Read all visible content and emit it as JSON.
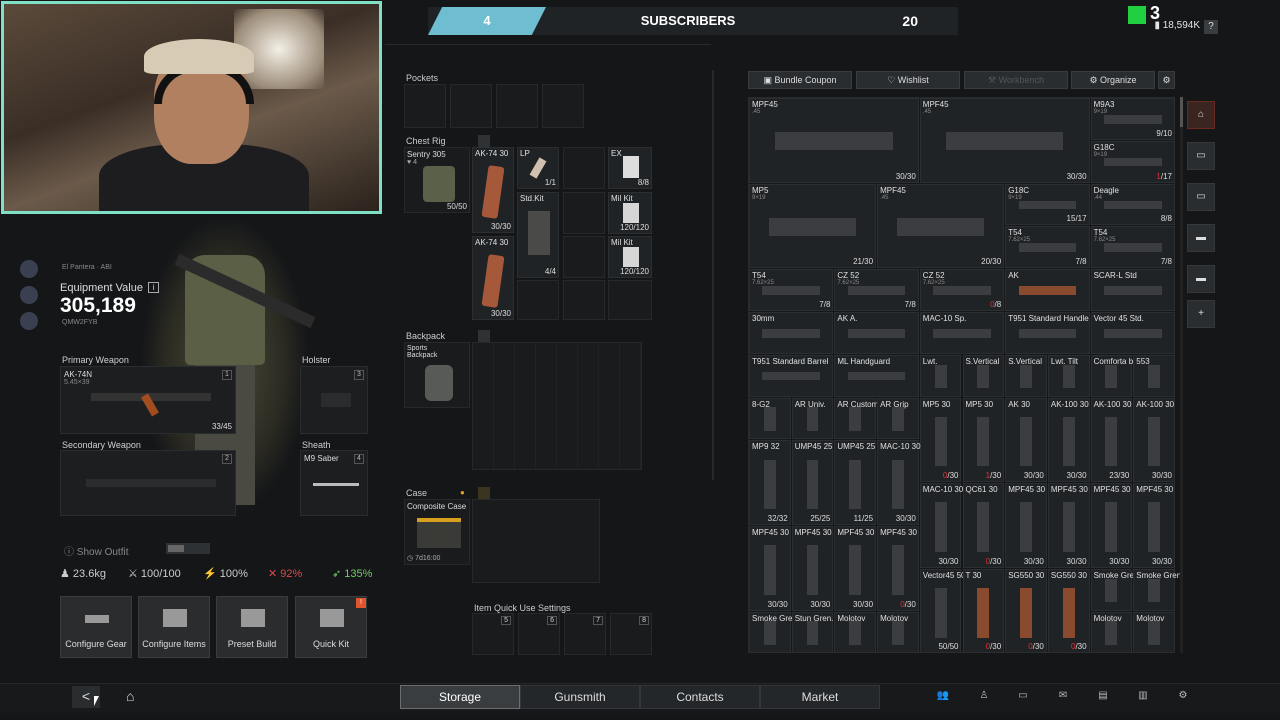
{
  "stream_overlay": {
    "subscribers_current": "4",
    "subscribers_label": "SUBSCRIBERS",
    "subscribers_goal": "20"
  },
  "header": {
    "level": "3",
    "currency": "18,594K",
    "help": "?"
  },
  "player": {
    "name": "El Pantera",
    "rank_tag": "ABI",
    "equipment_value_label": "Equipment Value",
    "equipment_value": "305,189",
    "player_id": "QMW2FYB"
  },
  "loadout": {
    "primary": {
      "title": "Primary Weapon",
      "name": "AK-74N",
      "caliber": "5.45×39",
      "slot": "1",
      "ammo": "33/45"
    },
    "secondary": {
      "title": "Secondary Weapon",
      "slot": "2"
    },
    "holster": {
      "title": "Holster",
      "slot": "3"
    },
    "sheath": {
      "title": "Sheath",
      "name": "M9 Saber",
      "slot": "4"
    }
  },
  "stats": {
    "show_outfit": "Show Outfit",
    "weight": "23.6kg",
    "durability": "100/100",
    "stamina": "100%",
    "health_penalty": "92%",
    "speed": "135%"
  },
  "actions": {
    "configure_gear": "Configure Gear",
    "configure_items": "Configure Items",
    "preset_build": "Preset Build",
    "quick_kit": "Quick Kit",
    "quick_kit_badge": "!"
  },
  "containers": {
    "pockets": "Pockets",
    "chest_rig": {
      "title": "Chest Rig",
      "name": "Sentry 305",
      "level": "4",
      "capacity": "50/50"
    },
    "chest_items": [
      {
        "name": "AK-74 30",
        "qty": "30/30"
      },
      {
        "name": "LP",
        "qty": "1/1"
      },
      {
        "name": "EX",
        "qty": "8/8"
      },
      {
        "name": "Std.Kit",
        "qty": "4/4"
      },
      {
        "name": "Mil Kit",
        "qty": "120/120"
      },
      {
        "name": "AK-74 30",
        "qty": "30/30"
      },
      {
        "name": "Mil Kit",
        "qty": "120/120"
      }
    ],
    "backpack": {
      "title": "Backpack",
      "name": "Sports Backpack"
    },
    "case": {
      "title": "Case",
      "name": "Composite Case",
      "timer": "7d16:00"
    },
    "quick_use": {
      "title": "Item Quick Use Settings",
      "slots": [
        "5",
        "6",
        "7",
        "8"
      ]
    }
  },
  "storage_toolbar": {
    "bundle_coupon": "Bundle Coupon",
    "wishlist": "Wishlist",
    "workbench": "Workbench",
    "organize": "Organize"
  },
  "storage_items": [
    {
      "name": "MPF45",
      "sub": ".45",
      "qty": "30/30"
    },
    {
      "name": "MPF45",
      "sub": ".45",
      "qty": "30/30"
    },
    {
      "name": "M9A3",
      "sub": "9×19",
      "qty": "9/10"
    },
    {
      "name": "G18C",
      "sub": "9×19",
      "qty": "1/17"
    },
    {
      "name": "MP5",
      "sub": "9×19",
      "qty": "21/30"
    },
    {
      "name": "MPF45",
      "sub": ".45",
      "qty": "20/30"
    },
    {
      "name": "G18C",
      "sub": "9×19",
      "qty": "15/17"
    },
    {
      "name": "Deagle",
      "sub": ".44",
      "qty": "8/8"
    },
    {
      "name": "T54",
      "sub": "7.62×25",
      "qty": "7/8"
    },
    {
      "name": "T54",
      "sub": "7.62×25",
      "qty": "7/8"
    },
    {
      "name": "T54",
      "sub": "7.62×25",
      "qty": "7/8"
    },
    {
      "name": "CZ 52",
      "sub": "7.62×25",
      "qty": "7/8"
    },
    {
      "name": "CZ 52",
      "sub": "7.62×25",
      "qty": "0/8"
    },
    {
      "name": "AK",
      "sub": "",
      "qty": ""
    },
    {
      "name": "SCAR-L Std",
      "sub": "",
      "qty": ""
    },
    {
      "name": "30mm",
      "sub": "",
      "qty": ""
    },
    {
      "name": "AK A.",
      "sub": "",
      "qty": ""
    },
    {
      "name": "MAC-10 Sp.",
      "sub": "",
      "qty": ""
    },
    {
      "name": "T951 Standard Handle",
      "sub": "",
      "qty": ""
    },
    {
      "name": "Vector 45 Std.",
      "sub": "",
      "qty": ""
    },
    {
      "name": "T951 Standard Barrel",
      "sub": "",
      "qty": ""
    },
    {
      "name": "ML Handguard",
      "sub": "",
      "qty": ""
    },
    {
      "name": "Lwt.",
      "sub": "",
      "qty": ""
    },
    {
      "name": "S.Vertical",
      "sub": "",
      "qty": ""
    },
    {
      "name": "S.Vertical",
      "sub": "",
      "qty": ""
    },
    {
      "name": "Lwt. Tilt",
      "sub": "",
      "qty": ""
    },
    {
      "name": "Comforta ble FG",
      "sub": "",
      "qty": ""
    },
    {
      "name": "553",
      "sub": "",
      "qty": ""
    },
    {
      "name": "8-G2",
      "sub": "",
      "qty": ""
    },
    {
      "name": "AR Univ.",
      "sub": "",
      "qty": ""
    },
    {
      "name": "AR Custom",
      "sub": "",
      "qty": ""
    },
    {
      "name": "AR Grip",
      "sub": "",
      "qty": ""
    },
    {
      "name": "MP5 30",
      "sub": "",
      "qty": "0/30"
    },
    {
      "name": "MP5 30",
      "sub": "",
      "qty": "1/30"
    },
    {
      "name": "AK 30",
      "sub": "",
      "qty": "30/30"
    },
    {
      "name": "AK-100 30",
      "sub": "",
      "qty": "30/30"
    },
    {
      "name": "AK-100 30",
      "sub": "",
      "qty": "23/30"
    },
    {
      "name": "AK-100 30",
      "sub": "",
      "qty": "30/30"
    },
    {
      "name": "MP9 32",
      "sub": "",
      "qty": "32/32"
    },
    {
      "name": "UMP45 25",
      "sub": "",
      "qty": "25/25"
    },
    {
      "name": "UMP45 25",
      "sub": "",
      "qty": "11/25"
    },
    {
      "name": "MAC-10 30",
      "sub": "",
      "qty": "30/30"
    },
    {
      "name": "MAC-10 30",
      "sub": "",
      "qty": "30/30"
    },
    {
      "name": "QC61 30",
      "sub": "",
      "qty": "0/30"
    },
    {
      "name": "MPF45 30",
      "sub": "",
      "qty": "30/30"
    },
    {
      "name": "MPF45 30",
      "sub": "",
      "qty": "30/30"
    },
    {
      "name": "MPF45 30",
      "sub": "",
      "qty": "30/30"
    },
    {
      "name": "MPF45 30",
      "sub": "",
      "qty": "30/30"
    },
    {
      "name": "MPF45 30",
      "sub": "",
      "qty": "30/30"
    },
    {
      "name": "MPF45 30",
      "sub": "",
      "qty": "30/30"
    },
    {
      "name": "MPF45 30",
      "sub": "",
      "qty": "30/30"
    },
    {
      "name": "MPF45 30",
      "sub": "",
      "qty": "0/30"
    },
    {
      "name": "Vector45 50",
      "sub": "",
      "qty": "50/50"
    },
    {
      "name": "T 30",
      "sub": "",
      "qty": "0/30"
    },
    {
      "name": "SG550 30",
      "sub": "",
      "qty": "0/30"
    },
    {
      "name": "SG550 30",
      "sub": "",
      "qty": "0/30"
    },
    {
      "name": "Smoke Gren",
      "sub": "",
      "qty": ""
    },
    {
      "name": "Smoke Gren",
      "sub": "",
      "qty": ""
    },
    {
      "name": "Smoke Gren",
      "sub": "",
      "qty": ""
    },
    {
      "name": "Stun Gren.",
      "sub": "",
      "qty": ""
    },
    {
      "name": "Molotov",
      "sub": "",
      "qty": ""
    },
    {
      "name": "Molotov",
      "sub": "",
      "qty": ""
    },
    {
      "name": "Molotov",
      "sub": "",
      "qty": ""
    },
    {
      "name": "Molotov",
      "sub": "",
      "qty": ""
    }
  ],
  "side_icons": [
    "home-icon",
    "crate-icon",
    "crate-icon",
    "truck-icon",
    "truck-icon",
    "plus-icon"
  ],
  "side_plus": "+",
  "bottom_nav": {
    "back": "<",
    "home": "⌂",
    "tabs": [
      "Storage",
      "Gunsmith",
      "Contacts",
      "Market"
    ],
    "icons": [
      "team-icon",
      "friend-icon",
      "chat-icon",
      "mail-icon",
      "shop-icon",
      "notes-icon",
      "settings-icon"
    ]
  },
  "colors": {
    "accent_teal": "#6fbdd0",
    "webcam_border": "#7fe0c6",
    "danger": "#e04a4a",
    "positive": "#6fcc63"
  }
}
